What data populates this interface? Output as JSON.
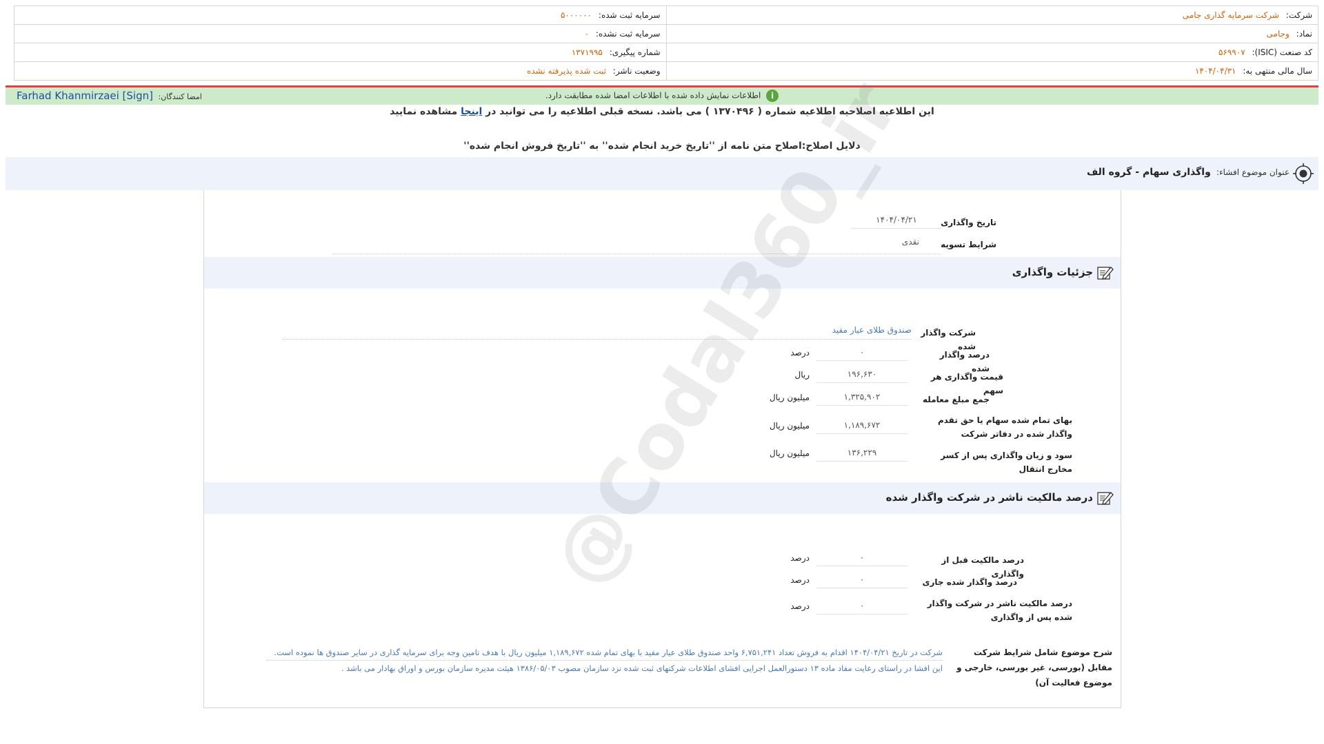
{
  "header": {
    "company_label": "شرکت:",
    "company_value": "شرکت سرمایه گذاری جامی",
    "symbol_label": "نماد:",
    "symbol_value": "وجامی",
    "isic_label": "کد صنعت (ISIC):",
    "isic_value": "۵۶۹۹۰۷",
    "fiscal_label": "سال مالی منتهی به:",
    "fiscal_value": "۱۴۰۴/۰۴/۳۱",
    "reg_capital_label": "سرمایه ثبت شده:",
    "reg_capital_value": "۵۰۰۰۰۰۰",
    "unreg_capital_label": "سرمایه ثبت نشده:",
    "unreg_capital_value": "۰",
    "tracking_label": "شماره پیگیری:",
    "tracking_value": "۱۳۷۱۹۹۵",
    "publisher_status_label": "وضعیت ناشر:",
    "publisher_status_value": "ثبت شده پذیرفته نشده"
  },
  "status_bar": {
    "message": "اطلاعات نمایش داده شده با اطلاعات امضا شده مطابقت دارد.",
    "signers_label": "امضا کنندگان:",
    "signer_name": "Farhad Khanmirzaei [Sign]"
  },
  "notes": {
    "correction_part1": "این اطلاعیه اصلاحیه اطلاعیه شماره ( ۱۳۷۰۴۹۶ ) می باشد. نسخه قبلی اطلاعیه را می توانید در",
    "correction_link": "اینجا",
    "correction_part2": "مشاهده نمایید",
    "reasons": "دلایل اصلاح:اصلاح متن نامه از ''تاریخ خرید انجام شده'' به ''تاریخ فروش انجام شده''"
  },
  "subject": {
    "label": "عنوان موضوع افشاء:",
    "value": "واگذاری سهام - گروه الف"
  },
  "top_fields": {
    "date_label": "تاریخ واگذاری",
    "date_value": "۱۴۰۴/۰۴/۲۱",
    "settlement_label": "شرایط تسویه",
    "settlement_value": "نقدی"
  },
  "details": {
    "title": "جزئیات واگذاری",
    "company_label": "شرکت واگذار شده",
    "company_value": "صندوق طلای عیار مفید",
    "percent_label": "درصد واگذار شده",
    "percent_value": "۰",
    "percent_unit": "درصد",
    "price_label": "قیمت واگذاری هر سهم",
    "price_value": "۱۹۶,۶۳۰",
    "price_unit": "ریال",
    "total_label": "جمع مبلغ معامله",
    "total_value": "۱,۳۲۵,۹۰۲",
    "total_unit": "میلیون ریال",
    "book_label": "بهای تمام شده سهام یا حق تقدم واگذار شده در دفاتر شرکت",
    "book_value": "۱,۱۸۹,۶۷۲",
    "book_unit": "میلیون ریال",
    "profit_label": "سود و زیان واگذاری پس از کسر مخارج انتقال",
    "profit_value": "۱۳۶,۲۲۹",
    "profit_unit": "میلیون ریال"
  },
  "ownership": {
    "title": "درصد مالکیت ناشر در شرکت واگذار شده",
    "before_label": "درصد مالکیت قبل از واگذاری",
    "before_value": "۰",
    "before_unit": "درصد",
    "current_label": "درصد واگذار شده جاری",
    "current_value": "۰",
    "current_unit": "درصد",
    "after_label": "درصد مالکیت ناشر در شرکت واگذار شده پس از واگذاری",
    "after_value": "۰",
    "after_unit": "درصد"
  },
  "description": {
    "label": "شرح موضوع شامل شرایط شرکت مقابل (بورسی، غیر بورسی، خارجی و موضوع فعالیت آن)",
    "line1": "شرکت در تاریخ ۱۴۰۴/۰۴/۲۱ اقدام به فروش تعداد ۶,۷۵۱,۲۴۱ واحد صندوق طلای عیار مفید با بهای تمام شده ۱,۱۸۹,۶۷۲ میلیون ریال با هدف تامین وجه برای سرمایه گذاری در سایر صندوق ها نموده است.",
    "line2": "این افشا در راستای رعایت مفاد ماده ۱۳ دستورالعمل اجرایی افشای اطلاعات شرکتهای ثبت شده نزد سازمان مصوب ۱۳۸۶/۰۵/۰۳ هیئت مدیره سازمان بورس و اوراق بهادار می باشد ."
  },
  "watermark": "@Codal360_ir"
}
